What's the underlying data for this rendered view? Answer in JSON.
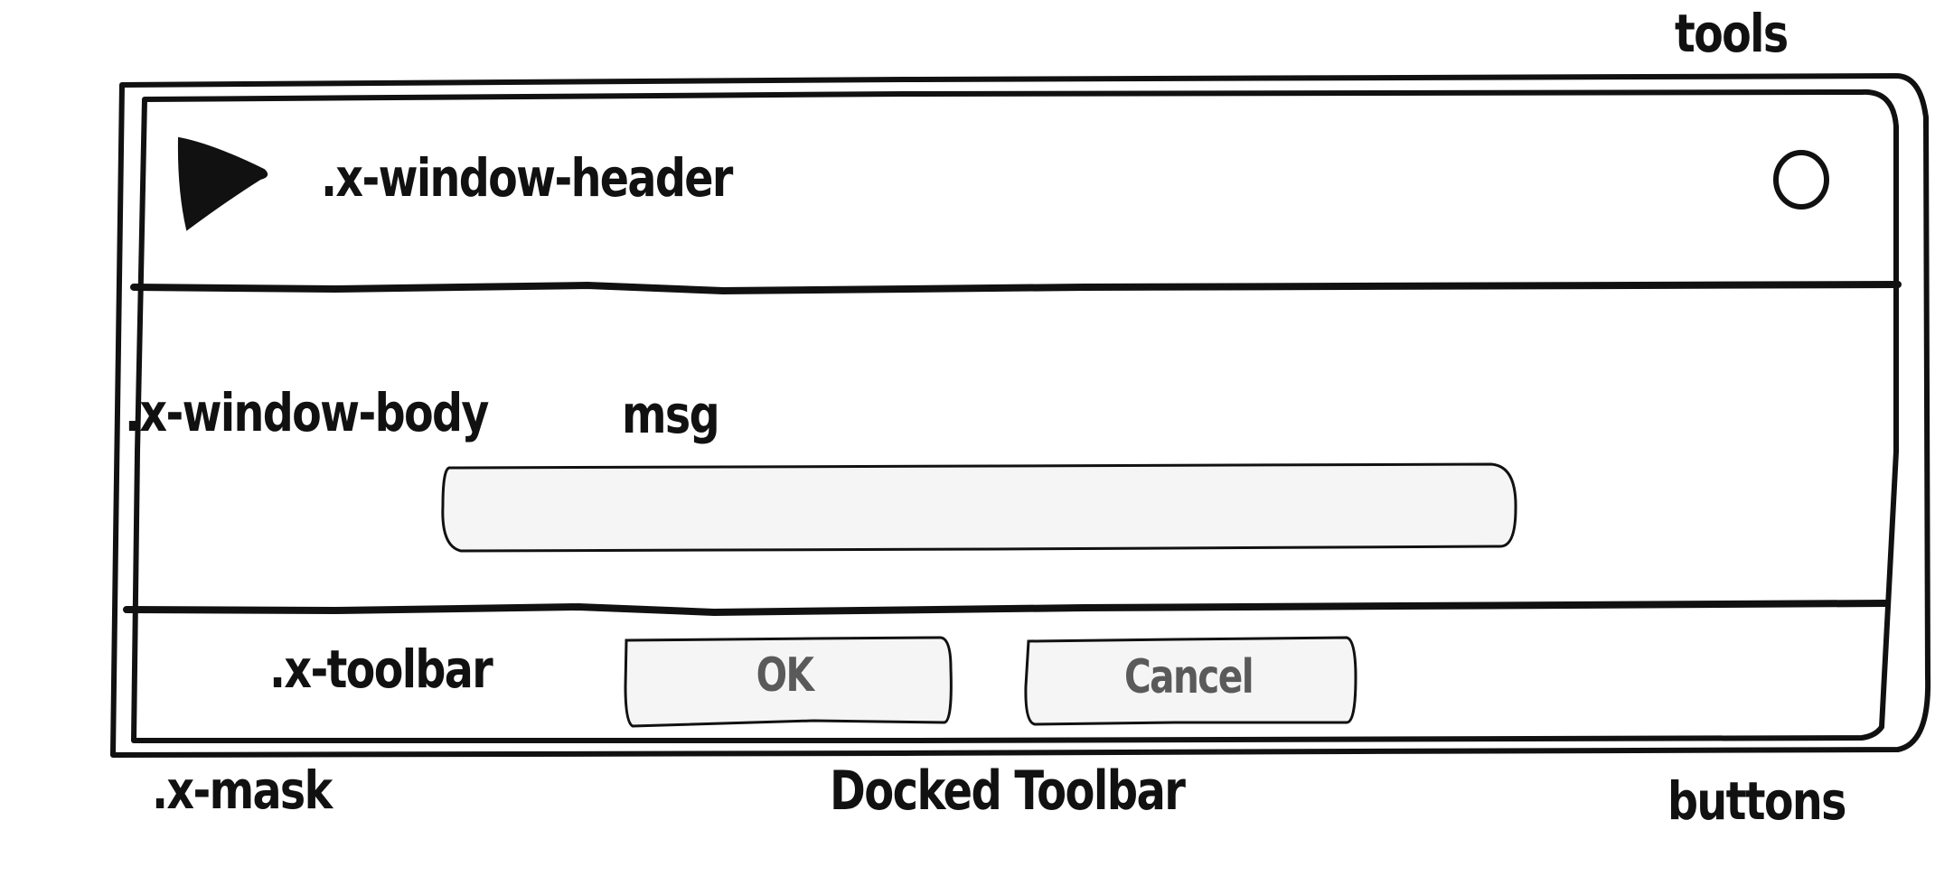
{
  "labels": {
    "tools": "tools",
    "header": ".x-window-header",
    "body": ".x-window-body",
    "msg": "msg",
    "toolbar": ".x-toolbar",
    "mask": ".x-mask",
    "docked_toolbar": "Docked Toolbar",
    "buttons": "buttons"
  },
  "toolbar": {
    "ok_label": "OK",
    "cancel_label": "Cancel"
  },
  "prompt_input": {
    "value": ""
  },
  "icons": {
    "header_icon": "play-triangle",
    "tool_icon": "circle-close-tool"
  },
  "colors": {
    "stroke": "#111111",
    "field_fill": "#f5f5f5",
    "button_text": "#5a5a5a"
  }
}
